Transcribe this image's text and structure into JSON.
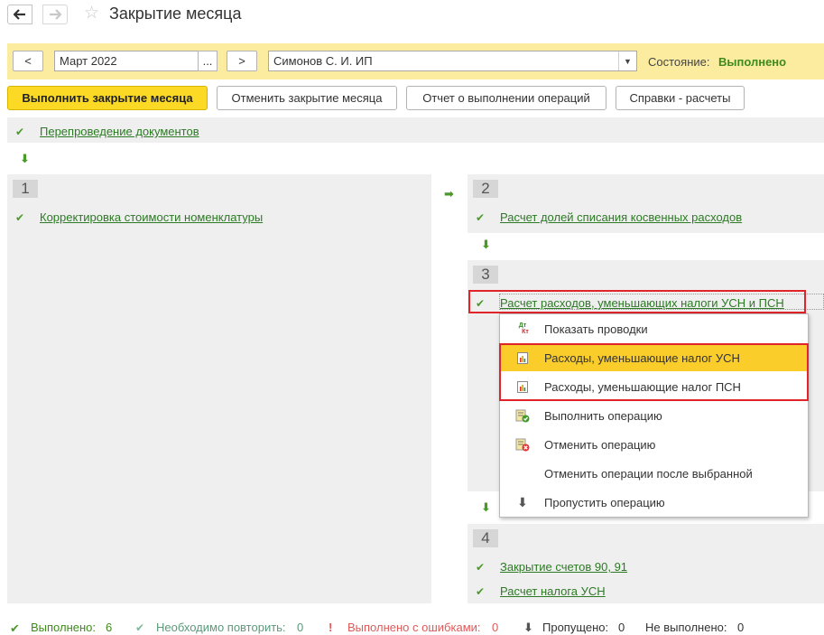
{
  "window": {
    "title": "Закрытие месяца",
    "back_icon": "arrow-left-icon",
    "forward_icon": "arrow-right-icon",
    "favorite_icon": "star-icon"
  },
  "period_bar": {
    "prev_label": "<",
    "period_value": "Март 2022",
    "period_picker_label": "...",
    "next_label": ">",
    "organization_value": "Симонов С. И. ИП",
    "state_label": "Состояние:",
    "state_value": "Выполнено"
  },
  "toolbar": {
    "run_label": "Выполнить закрытие месяца",
    "cancel_label": "Отменить закрытие месяца",
    "report_label": "Отчет о выполнении операций",
    "refs_label": "Справки - расчеты"
  },
  "operations": {
    "repost": "Перепроведение документов",
    "stage1": {
      "number": "1",
      "item": "Корректировка стоимости номенклатуры"
    },
    "stage2": {
      "number": "2",
      "item": "Расчет долей списания косвенных расходов"
    },
    "stage3": {
      "number": "3",
      "item": "Расчет расходов, уменьшающих налоги УСН и ПСН"
    },
    "stage4": {
      "number": "4",
      "items": [
        "Закрытие счетов 90, 91",
        "Расчет налога УСН"
      ]
    }
  },
  "context_menu": {
    "items": [
      {
        "label": "Показать проводки",
        "icon": "dt-kt-icon"
      },
      {
        "label": "Расходы, уменьшающие налог УСН",
        "icon": "report-icon"
      },
      {
        "label": "Расходы, уменьшающие налог ПСН",
        "icon": "report-icon"
      },
      {
        "label": "Выполнить операцию",
        "icon": "execute-operation-icon"
      },
      {
        "label": "Отменить операцию",
        "icon": "cancel-operation-icon"
      },
      {
        "label": "Отменить операции после выбранной",
        "icon": ""
      },
      {
        "label": "Пропустить операцию",
        "icon": "skip-arrow-icon"
      }
    ],
    "highlighted_index": 1
  },
  "status_bar": {
    "done_label": "Выполнено:",
    "done_count": "6",
    "repeat_label": "Необходимо повторить:",
    "repeat_count": "0",
    "errors_label": "Выполнено с ошибками:",
    "errors_count": "0",
    "skipped_label": "Пропущено:",
    "skipped_count": "0",
    "notdone_label": "Не выполнено:",
    "notdone_count": "0"
  },
  "colors": {
    "accent_yellow": "#fbd924",
    "panel_yellow": "#fbeca0",
    "success_green": "#3f8a1c",
    "error_red": "#e05a5a",
    "highlight_red_box": "#e0242a",
    "menu_highlight": "#fbcd2b"
  }
}
